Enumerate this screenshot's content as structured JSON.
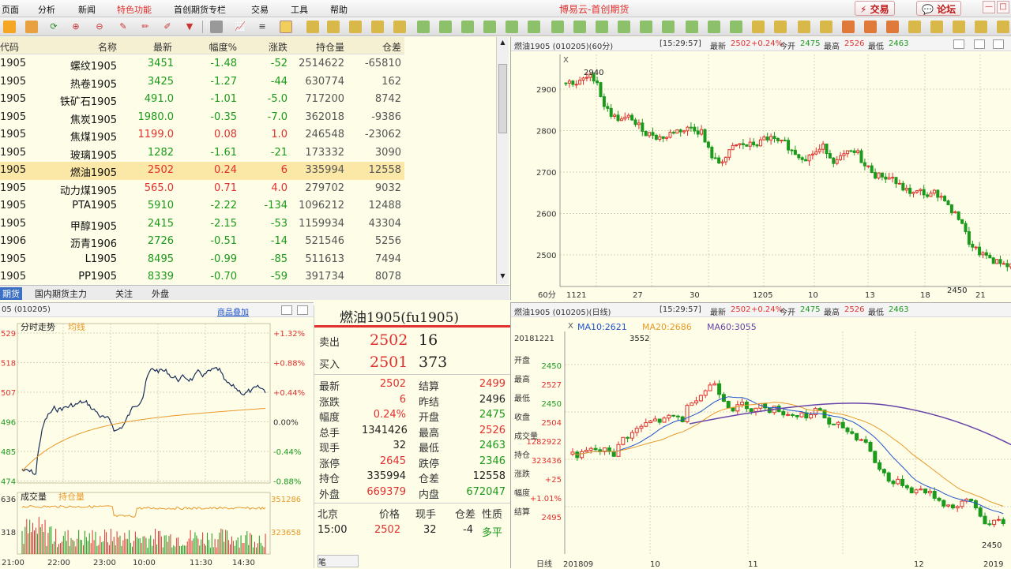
{
  "menu": [
    "页面",
    "分析",
    "新闻",
    "特色功能",
    "首创期货专栏",
    "交易",
    "工具",
    "帮助"
  ],
  "app_title": "博易云-首创期货",
  "buttons": {
    "trade": "交易",
    "forum": "论坛"
  },
  "colors": {
    "up": "#e0312e",
    "down": "#1b9a1b",
    "accent": "#e0312e",
    "selected_row": "#fbe7a6"
  },
  "quote_table": {
    "headers": [
      "代码",
      "名称",
      "最新",
      "幅度%",
      "涨跌",
      "持仓量",
      "仓差"
    ],
    "rows": [
      {
        "code": "1905",
        "name": "螺纹1905",
        "last": "3451",
        "pct": "-1.48",
        "chg": "-52",
        "oi": "2514622",
        "diff": "-65810",
        "trend": "down"
      },
      {
        "code": "1905",
        "name": "热卷1905",
        "last": "3425",
        "pct": "-1.27",
        "chg": "-44",
        "oi": "630774",
        "diff": "162",
        "trend": "down"
      },
      {
        "code": "1905",
        "name": "铁矿石1905",
        "last": "491.0",
        "pct": "-1.01",
        "chg": "-5.0",
        "oi": "717200",
        "diff": "8742",
        "trend": "down"
      },
      {
        "code": "1905",
        "name": "焦炭1905",
        "last": "1980.0",
        "pct": "-0.35",
        "chg": "-7.0",
        "oi": "362018",
        "diff": "-9386",
        "trend": "down"
      },
      {
        "code": "1905",
        "name": "焦煤1905",
        "last": "1199.0",
        "pct": "0.08",
        "chg": "1.0",
        "oi": "246548",
        "diff": "-23062",
        "trend": "up"
      },
      {
        "code": "1905",
        "name": "玻璃1905",
        "last": "1282",
        "pct": "-1.61",
        "chg": "-21",
        "oi": "173332",
        "diff": "3090",
        "trend": "down"
      },
      {
        "code": "1905",
        "name": "燃油1905",
        "last": "2502",
        "pct": "0.24",
        "chg": "6",
        "oi": "335994",
        "diff": "12558",
        "trend": "up",
        "selected": true
      },
      {
        "code": "1905",
        "name": "动力煤1905",
        "last": "565.0",
        "pct": "0.71",
        "chg": "4.0",
        "oi": "279702",
        "diff": "9032",
        "trend": "up"
      },
      {
        "code": "1905",
        "name": "PTA1905",
        "last": "5910",
        "pct": "-2.22",
        "chg": "-134",
        "oi": "1096212",
        "diff": "12488",
        "trend": "down"
      },
      {
        "code": "1905",
        "name": "甲醇1905",
        "last": "2415",
        "pct": "-2.15",
        "chg": "-53",
        "oi": "1159934",
        "diff": "43304",
        "trend": "down"
      },
      {
        "code": "1906",
        "name": "沥青1906",
        "last": "2726",
        "pct": "-0.51",
        "chg": "-14",
        "oi": "521546",
        "diff": "5256",
        "trend": "down"
      },
      {
        "code": "1905",
        "name": "L1905",
        "last": "8495",
        "pct": "-0.99",
        "chg": "-85",
        "oi": "511613",
        "diff": "7494",
        "trend": "down"
      },
      {
        "code": "1905",
        "name": "PP1905",
        "last": "8339",
        "pct": "-0.70",
        "chg": "-59",
        "oi": "391734",
        "diff": "8078",
        "trend": "down"
      }
    ]
  },
  "bottom_tabs": [
    "期货",
    "国内期货主力",
    "关注",
    "外盘"
  ],
  "intraday": {
    "header": "05 (010205)",
    "link": "商品叠加",
    "title": "分时走势",
    "legend": "均线",
    "price_ticks": [
      "529",
      "518",
      "507",
      "496",
      "485",
      "474"
    ],
    "pct_ticks": [
      "+1.32%",
      "+0.88%",
      "+0.44%",
      "0.00%",
      "-0.44%",
      "-0.88%"
    ],
    "vol_title": "成交量",
    "oi_label": "持仓量",
    "vol_ticks": [
      "636",
      "318"
    ],
    "oi_ticks": [
      "351286",
      "323658"
    ],
    "time_labels": [
      "21:00",
      "22:00",
      "23:00",
      "10:00",
      "11:30",
      "14:30"
    ]
  },
  "info": {
    "title": "燃油1905(fu1905)",
    "ask": {
      "label": "卖出",
      "price": "2502",
      "vol": "16"
    },
    "bid": {
      "label": "买入",
      "price": "2501",
      "vol": "373"
    },
    "fields": [
      {
        "l": "最新",
        "v": "2502",
        "c": "red",
        "l2": "结算",
        "v2": "2499",
        "c2": "red"
      },
      {
        "l": "涨跌",
        "v": "6",
        "c": "red",
        "l2": "昨结",
        "v2": "2496",
        "c2": "blk"
      },
      {
        "l": "幅度",
        "v": "0.24%",
        "c": "red",
        "l2": "开盘",
        "v2": "2475",
        "c2": "green"
      },
      {
        "l": "总手",
        "v": "1341426",
        "c": "blk",
        "l2": "最高",
        "v2": "2526",
        "c2": "red"
      },
      {
        "l": "现手",
        "v": "32",
        "c": "blk",
        "l2": "最低",
        "v2": "2463",
        "c2": "green"
      },
      {
        "l": "涨停",
        "v": "2645",
        "c": "red",
        "l2": "跌停",
        "v2": "2346",
        "c2": "green"
      },
      {
        "l": "持仓",
        "v": "335994",
        "c": "blk",
        "l2": "仓差",
        "v2": "12558",
        "c2": "blk"
      },
      {
        "l": "外盘",
        "v": "669379",
        "c": "red",
        "l2": "内盘",
        "v2": "672047",
        "c2": "green"
      }
    ],
    "tick_header": {
      "place": "北京",
      "price": "价格",
      "vol": "现手",
      "diff": "仓差",
      "nature": "性质"
    },
    "tick": {
      "time": "15:00",
      "price": "2502",
      "vol": "32",
      "diff": "-4",
      "nature": "多平"
    }
  },
  "chart60": {
    "header": "燃油1905 (010205)(60分)",
    "time": "[15:29:57]",
    "last_label": "最新",
    "last": "2502",
    "chg": "+0.24%",
    "open_label": "今开",
    "open": "2475",
    "high_label": "最高",
    "high": "2526",
    "low_label": "最低",
    "low": "2463",
    "y_ticks": [
      "2900",
      "2800",
      "2700",
      "2600",
      "2500"
    ],
    "x_labels": [
      "60分",
      "1121",
      "27",
      "30",
      "1205",
      "10",
      "13",
      "18",
      "21"
    ],
    "hi_mark": "2940",
    "lo_mark": "2450"
  },
  "chartDay": {
    "header": "燃油1905 (010205)(日线)",
    "ma": {
      "ma10": "MA10:2621",
      "ma20": "MA20:2686",
      "ma60": "MA60:3055"
    },
    "hi_mark": "3552",
    "lo_mark": "2450",
    "side": [
      {
        "l": "20181221",
        "v": ""
      },
      {
        "l": "开盘",
        "v": "2450"
      },
      {
        "l": "最高",
        "v": "2527"
      },
      {
        "l": "最低",
        "v": "2450"
      },
      {
        "l": "收盘",
        "v": "2504"
      },
      {
        "l": "成交量",
        "v": "1282922"
      },
      {
        "l": "持仓",
        "v": "323436"
      },
      {
        "l": "涨跌",
        "v": "+25"
      },
      {
        "l": "幅度",
        "v": "+1.01%"
      },
      {
        "l": "结算",
        "v": "2495"
      }
    ],
    "x_labels": [
      "日线",
      "201809",
      "10",
      "11",
      "12",
      "2019"
    ]
  },
  "chart_data": [
    {
      "type": "line",
      "title": "分时走势",
      "series": [
        {
          "name": "均线"
        }
      ],
      "x": [
        "21:00",
        "22:00",
        "23:00",
        "10:00",
        "11:30",
        "14:30"
      ]
    },
    {
      "type": "candlestick",
      "title": "燃油1905 60分",
      "ylim": [
        2450,
        2950
      ]
    },
    {
      "type": "candlestick",
      "title": "燃油1905 日线",
      "series": [
        {
          "name": "MA10"
        },
        {
          "name": "MA20"
        },
        {
          "name": "MA60"
        }
      ]
    }
  ]
}
